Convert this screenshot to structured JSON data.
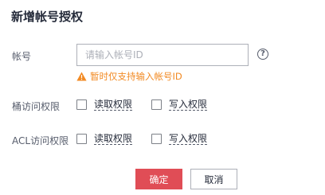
{
  "dialog": {
    "title": "新增帐号授权"
  },
  "account": {
    "label": "帐号",
    "placeholder": "请输入帐号ID",
    "value": "",
    "warning": "暂时仅支持输入帐号ID"
  },
  "bucket_access": {
    "label": "桶访问权限",
    "read_label": "读取权限",
    "write_label": "写入权限",
    "read_checked": false,
    "write_checked": false
  },
  "acl_access": {
    "label": "ACL访问权限",
    "read_label": "读取权限",
    "write_label": "写入权限",
    "read_checked": false,
    "write_checked": false
  },
  "buttons": {
    "confirm": "确定",
    "cancel": "取消"
  },
  "colors": {
    "primary": "#e04d56",
    "warning": "#f28a23"
  }
}
